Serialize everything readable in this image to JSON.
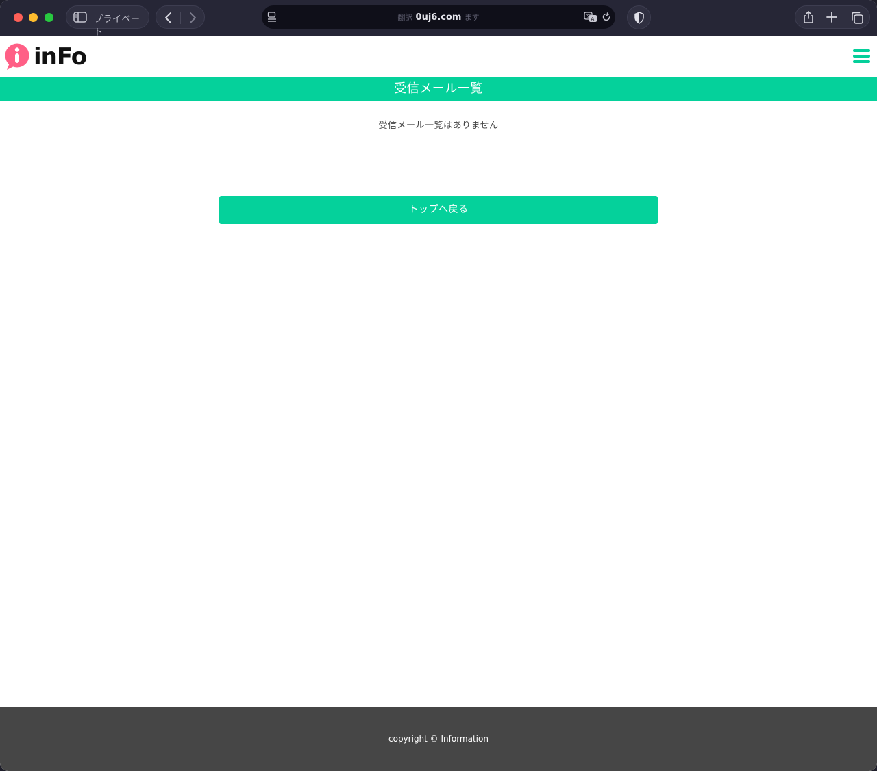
{
  "browser": {
    "profile_label": "プライベート",
    "address": {
      "prefix": "翻訳",
      "host": "0uj6.com",
      "suffix": "ます"
    },
    "icons": [
      "sidebar-icon",
      "back-icon",
      "forward-icon",
      "page-icon",
      "translate-icon",
      "reload-icon",
      "shield-icon",
      "share-icon",
      "new-tab-icon",
      "tabs-overview-icon"
    ]
  },
  "site": {
    "logo_text": "inFo",
    "brand_color": "#05d19b",
    "logo_color": "#ff5f86"
  },
  "main": {
    "title": "受信メール一覧",
    "empty_message": "受信メール一覧はありません",
    "back_button_label": "トップへ戻る"
  },
  "footer": {
    "copyright": "copyright © Information"
  }
}
